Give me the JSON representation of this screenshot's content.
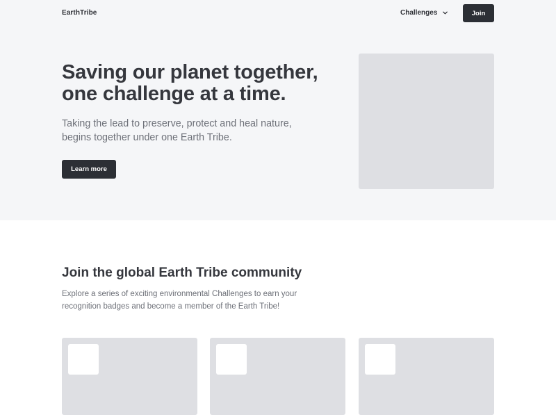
{
  "nav": {
    "logo": "EarthTribe",
    "menu_label": "Challenges",
    "join_label": "Join"
  },
  "hero": {
    "title": "Saving our planet together, one challenge at a time.",
    "subtitle": "Taking the lead to preserve, protect and heal nature, begins together under one Earth Tribe.",
    "cta_label": "Learn more"
  },
  "community": {
    "title": "Join the global Earth Tribe community",
    "subtitle": "Explore a series of exciting environmental Challenges to earn your recognition badges and become a member of the Earth Tribe!"
  },
  "colors": {
    "hero_background": "#f5f6f8",
    "primary_button": "#2c2f35",
    "placeholder": "#dedfe3",
    "heading": "#35373d",
    "body_text": "#6d7078"
  },
  "icons": {
    "menu_chevron": "chevron-down-icon"
  }
}
